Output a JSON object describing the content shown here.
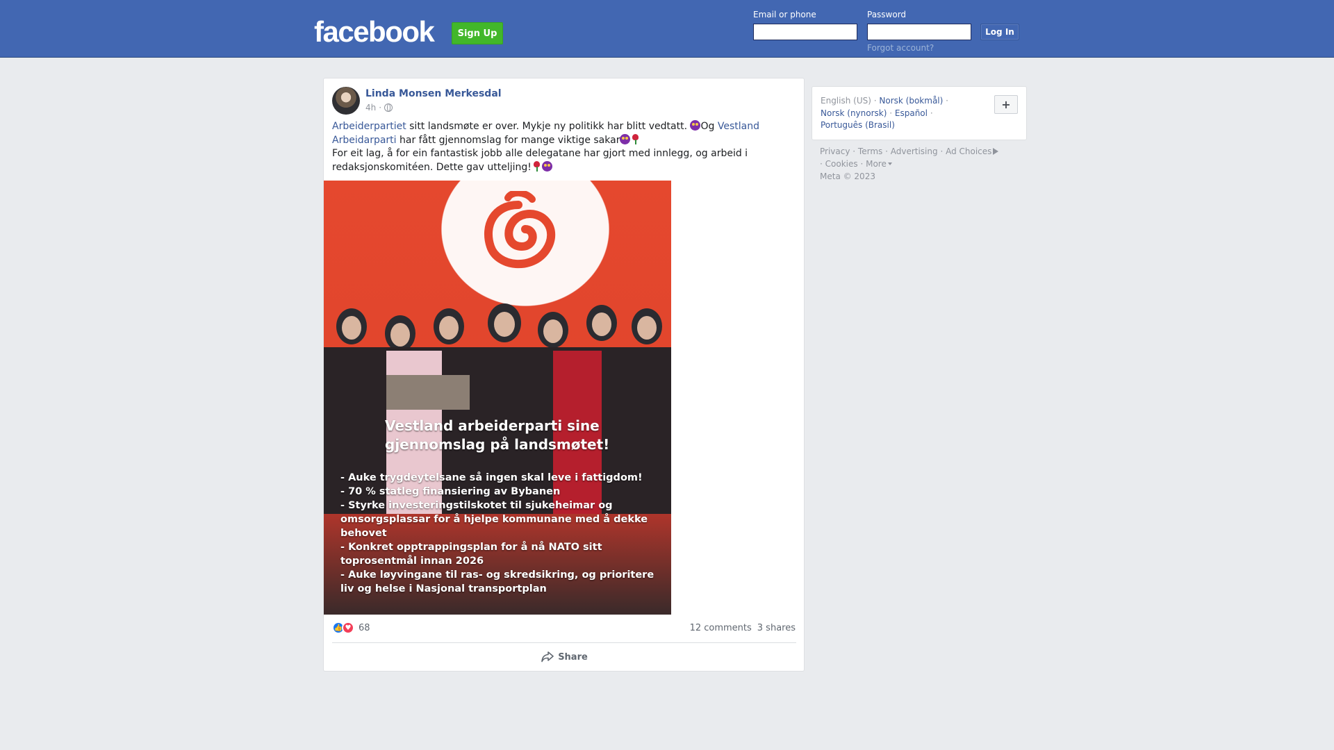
{
  "header": {
    "logo": "facebook",
    "signup_label": "Sign Up",
    "email_label": "Email or phone",
    "email_value": "",
    "password_label": "Password",
    "password_value": "",
    "login_label": "Log In",
    "forgot_label": "Forgot account?"
  },
  "post": {
    "author": "Linda Monsen Merkesdal",
    "time": "4h",
    "visibility_icon": "globe-icon",
    "text": {
      "link1": "Arbeiderpartiet",
      "t1": " sitt landsmøte er over. Mykje ny politikk har blitt vedtatt. ",
      "t2": "Og ",
      "link2": "Vestland Arbeidarparti",
      "t3": " har fått gjennomslag for mange viktige sakar",
      "t4": "For eit lag, å for ein fantastisk jobb alle delegatane har gjort med innlegg, og arbeid i redaksjonskomitéen. Dette gav utteljing!"
    },
    "image": {
      "title_line1": "Vestland arbeiderparti sine",
      "title_line2": "gjennomslag på landsmøtet!",
      "items": [
        "- Auke trygdeytelsane så ingen skal leve i fattigdom!",
        "- 70 % statleg finansiering av Bybanen",
        "- Styrke investeringstilskotet til sjukeheimar og omsorgsplassar for å hjelpe kommunane med å dekke behovet",
        "- Konkret opptrappingsplan for å nå NATO sitt toprosentmål innan 2026",
        "- Auke løyvingane til ras- og skredsikring, og prioritere liv og helse i Nasjonal transportplan"
      ]
    },
    "reaction_count": "68",
    "comments": "12 comments",
    "shares": "3 shares",
    "share_label": "Share",
    "colors": {
      "link": "#385898",
      "like": "#1877f2",
      "love": "#f33e58"
    }
  },
  "sidebar": {
    "languages": [
      "English (US)",
      "Norsk (bokmål)",
      "Norsk (nynorsk)",
      "Español",
      "Português (Brasil)"
    ],
    "plus_label": "+",
    "footer": {
      "privacy": "Privacy",
      "terms": "Terms",
      "advertising": "Advertising",
      "adchoices": "Ad Choices",
      "cookies": "Cookies",
      "more": "More",
      "copyright": "Meta © 2023"
    }
  }
}
